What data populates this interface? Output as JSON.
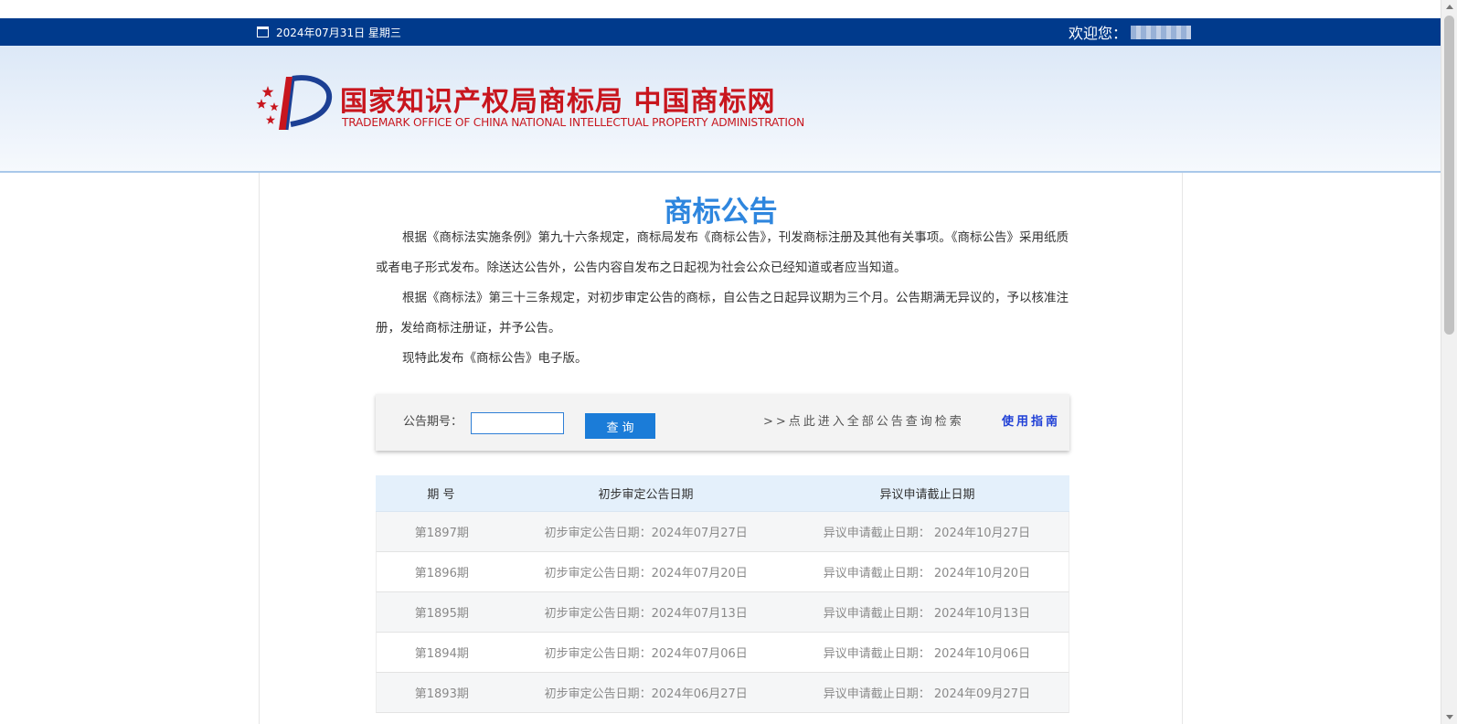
{
  "topbar": {
    "date": "2024年07月31日 星期三",
    "welcome": "欢迎您："
  },
  "header": {
    "title_cn": "国家知识产权局商标局 中国商标网",
    "title_en": "TRADEMARK OFFICE OF CHINA NATIONAL INTELLECTUAL PROPERTY ADMINISTRATION"
  },
  "main": {
    "title": "商标公告",
    "paragraphs": [
      "根据《商标法实施条例》第九十六条规定，商标局发布《商标公告》，刊发商标注册及其他有关事项。《商标公告》采用纸质或者电子形式发布。除送达公告外，公告内容自发布之日起视为社会公众已经知道或者应当知道。",
      "根据《商标法》第三十三条规定，对初步审定公告的商标，自公告之日起异议期为三个月。公告期满无异议的，予以核准注册，发给商标注册证，并予公告。",
      "现特此发布《商标公告》电子版。"
    ]
  },
  "search": {
    "label": "公告期号：",
    "input_value": "",
    "button_label": "查询",
    "all_link": ">>点此进入全部公告查询检索",
    "guide_link": "使用指南"
  },
  "table": {
    "headers": [
      "期 号",
      "初步审定公告日期",
      "异议申请截止日期"
    ],
    "rows": [
      [
        "第1897期",
        "初步审定公告日期：2024年07月27日",
        "异议申请截止日期： 2024年10月27日"
      ],
      [
        "第1896期",
        "初步审定公告日期：2024年07月20日",
        "异议申请截止日期： 2024年10月20日"
      ],
      [
        "第1895期",
        "初步审定公告日期：2024年07月13日",
        "异议申请截止日期： 2024年10月13日"
      ],
      [
        "第1894期",
        "初步审定公告日期：2024年07月06日",
        "异议申请截止日期： 2024年10月06日"
      ],
      [
        "第1893期",
        "初步审定公告日期：2024年06月27日",
        "异议申请截止日期： 2024年09月27日"
      ]
    ]
  },
  "colors": {
    "topbar": "#003a8c",
    "brand_red": "#c8161e",
    "title_blue": "#2e86de",
    "button_blue": "#1b7cd8",
    "table_header_bg": "#e4f0fb"
  }
}
